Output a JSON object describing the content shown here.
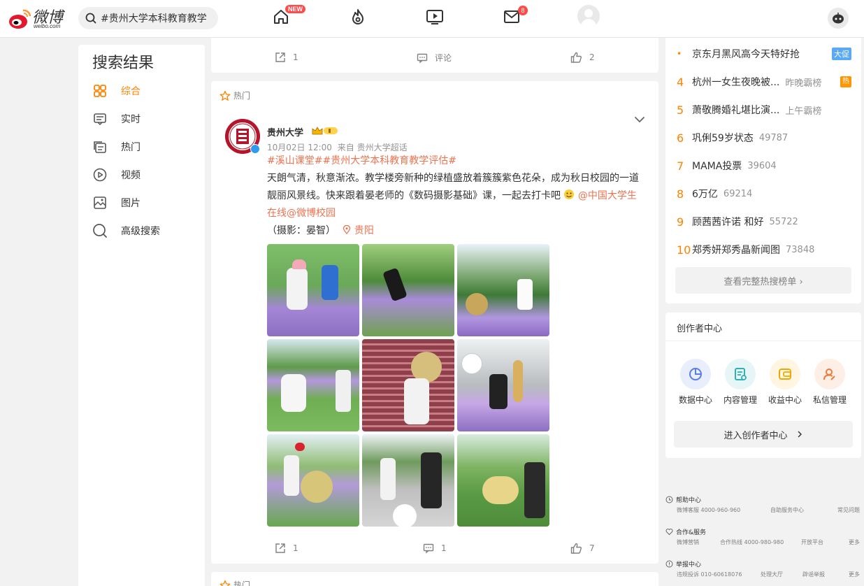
{
  "header": {
    "logo_cn": "微博",
    "logo_en": "weibo.com",
    "search_value": "#贵州大学本科教育教学",
    "new_badge": "NEW",
    "message_count": "8"
  },
  "leftnav": {
    "title": "搜索结果",
    "items": [
      {
        "label": "综合",
        "icon": "grid-icon"
      },
      {
        "label": "实时",
        "icon": "realtime-icon"
      },
      {
        "label": "热门",
        "icon": "hot-doc-icon"
      },
      {
        "label": "视频",
        "icon": "video-icon"
      },
      {
        "label": "图片",
        "icon": "image-icon"
      },
      {
        "label": "高级搜索",
        "icon": "search-icon"
      }
    ]
  },
  "feed": {
    "top_actions": {
      "repost": "1",
      "comment": "评论",
      "like": "2"
    },
    "post": {
      "hot_label": "热门",
      "user": "贵州大学",
      "time": "10月02日 12:00",
      "source": "来自 贵州大学超话",
      "hashtags": "#溪山课堂##贵州大学本科教育教学评估#",
      "text1": "天朗气清，秋意渐浓。教学楼旁新种的绿植盛放着簇簇紫色花朵，成为秋日校园的一道",
      "text2": "靓丽风景线。快来跟着晏老师的《数码摄影基础》课，一起去打卡吧",
      "mention1": "@中国大学生",
      "mention2": "在线@微博校园",
      "credit": "（摄影：晏智）",
      "location": "贵阳",
      "repost": "1",
      "comment": "1",
      "like": "7"
    },
    "next_hot_label": "热门"
  },
  "hotsearch": {
    "items": [
      {
        "rank": "•",
        "title": "京东月黑风高今天特好抢",
        "num": "",
        "tag": "大促"
      },
      {
        "rank": "4",
        "title": "杭州一女生夜晚被...",
        "num": "昨晚霸榜",
        "tag": "热"
      },
      {
        "rank": "5",
        "title": "萧敬腾婚礼堪比演...",
        "num": "上午霸榜",
        "tag": ""
      },
      {
        "rank": "6",
        "title": "巩俐59岁状态",
        "num": "49787",
        "tag": ""
      },
      {
        "rank": "7",
        "title": "MAMA投票",
        "num": "39604",
        "tag": ""
      },
      {
        "rank": "8",
        "title": "6万亿",
        "num": "69214",
        "tag": ""
      },
      {
        "rank": "9",
        "title": "顾茜茜许诺 和好",
        "num": "55722",
        "tag": ""
      },
      {
        "rank": "10",
        "title": "郑秀妍郑秀晶新闻图",
        "num": "73848",
        "tag": ""
      }
    ],
    "more": "查看完整热搜榜单 ›"
  },
  "creator": {
    "title": "创作者中心",
    "items": [
      {
        "label": "数据中心",
        "icon": "data-icon",
        "color": "#e8eefc"
      },
      {
        "label": "内容管理",
        "icon": "content-icon",
        "color": "#e6f6f7"
      },
      {
        "label": "收益中心",
        "icon": "income-icon",
        "color": "#fff5e0"
      },
      {
        "label": "私信管理",
        "icon": "message-mgmt-icon",
        "color": "#fdeee6"
      }
    ],
    "enter": "进入创作者中心"
  },
  "footer": {
    "help": {
      "title": "帮助中心",
      "items": [
        "微博客服 4000-960-960",
        "自助服务中心",
        "常见问题"
      ]
    },
    "coop": {
      "title": "合作&服务",
      "items": [
        "微博营销",
        "合作热线 4000-980-980",
        "开放平台",
        "更多"
      ]
    },
    "report": {
      "title": "举报中心",
      "items": [
        "违规投诉 010-60618076",
        "处理大厅",
        "辟谣举报",
        "更多"
      ]
    }
  }
}
